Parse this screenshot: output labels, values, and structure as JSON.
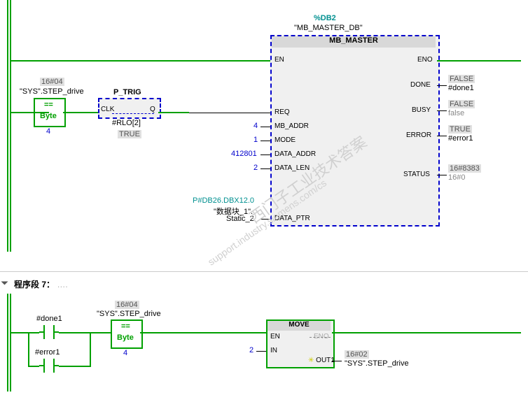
{
  "header": {
    "db_tag": "%DB2",
    "db_name": "\"MB_MASTER_DB\""
  },
  "block_main": {
    "title": "MB_MASTER",
    "en": "EN",
    "eno": "ENO",
    "inputs": {
      "req": "REQ",
      "mb_addr": "MB_ADDR",
      "mode": "MODE",
      "data_addr": "DATA_ADDR",
      "data_len": "DATA_LEN",
      "data_ptr": "DATA_PTR"
    },
    "outputs": {
      "done": "DONE",
      "busy": "BUSY",
      "error": "ERROR",
      "status": "STATUS"
    },
    "in_vals": {
      "mb_addr": "4",
      "mode": "1",
      "data_addr": "412801",
      "data_len": "2"
    },
    "out_vals": {
      "done_val": "FALSE",
      "done_tag": "#done1",
      "busy_val": "FALSE",
      "busy_tag": "false",
      "error_val": "TRUE",
      "error_tag": "#error1",
      "status_val": "16#8383",
      "status_tag": "16#0"
    },
    "data_ptr_top": "P#DB26.DBX12.0",
    "data_ptr_mid": "\"数据块_1\".",
    "data_ptr_bot": "Static_2"
  },
  "ptrig": {
    "title": "P_TRIG",
    "clk": "CLK",
    "q": "Q",
    "tag": "#RLO[2]",
    "val": "TRUE"
  },
  "compare": {
    "const_top": "16#04",
    "tag": "\"SYS\".STEP_drive",
    "op": "==",
    "type": "Byte",
    "val": "4"
  },
  "network7": {
    "title": "程序段 7：",
    "dots": "….",
    "done_tag": "#done1",
    "error_tag": "#error1",
    "cmp_const": "16#04",
    "cmp_tag": "\"SYS\".STEP_drive",
    "cmp_op": "==",
    "cmp_type": "Byte",
    "cmp_val": "4",
    "move_title": "MOVE",
    "move_en": "EN",
    "move_eno": "ENO",
    "move_in": "IN",
    "move_out": "OUT1",
    "move_in_val": "2",
    "move_out_const": "16#02",
    "move_out_tag": "\"SYS\".STEP_drive"
  }
}
